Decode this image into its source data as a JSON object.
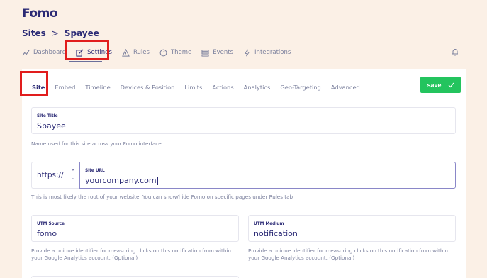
{
  "logo": "Fomo",
  "breadcrumb": {
    "root": "Sites",
    "separator": ">",
    "current": "Spayee"
  },
  "topnav": [
    {
      "label": "Dashboard",
      "icon": "trend-icon"
    },
    {
      "label": "Settings",
      "icon": "edit-icon",
      "active": true
    },
    {
      "label": "Rules",
      "icon": "warning-icon"
    },
    {
      "label": "Theme",
      "icon": "palette-icon"
    },
    {
      "label": "Events",
      "icon": "list-icon"
    },
    {
      "label": "Integrations",
      "icon": "plug-icon"
    }
  ],
  "tabs": [
    "Site",
    "Embed",
    "Timeline",
    "Devices & Position",
    "Limits",
    "Actions",
    "Analytics",
    "Geo-Targeting",
    "Advanced"
  ],
  "save_label": "save",
  "site_title": {
    "label": "Site Title",
    "value": "Spayee",
    "help": "Name used for this site across your Fomo interface"
  },
  "site_url": {
    "protocol": "https://",
    "label": "Site URL",
    "value": "yourcompany.com",
    "help": "This is most likely the root of your website. You can show/hide Fomo on specific pages under Rules tab"
  },
  "utm_source": {
    "label": "UTM Source",
    "value": "fomo",
    "help": "Provide a unique identifier for measuring clicks on this notification from within your Google Analytics account. (Optional)"
  },
  "utm_medium": {
    "label": "UTM Medium",
    "value": "notification",
    "help": "Provide a unique identifier for measuring clicks on this notification from within your Google Analytics account. (Optional)"
  },
  "colors": {
    "brand": "#2b2a75",
    "save": "#23c45e",
    "highlight": "#e11d1d",
    "background": "#fbf0e6"
  }
}
